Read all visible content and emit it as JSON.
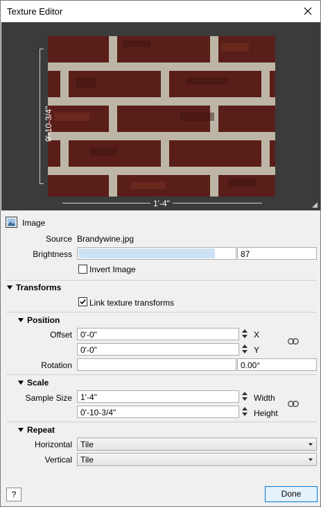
{
  "window": {
    "title": "Texture Editor"
  },
  "preview": {
    "height_label": "0'-10-3/4\"",
    "width_label": "1'-4\""
  },
  "image_section": {
    "label": "Image",
    "source_label": "Source",
    "source_value": "Brandywine.jpg",
    "brightness_label": "Brightness",
    "brightness_value": "87",
    "invert_label": "Invert Image",
    "invert_checked": false
  },
  "transforms": {
    "label": "Transforms",
    "link_label": "Link texture transforms",
    "link_checked": true
  },
  "position": {
    "label": "Position",
    "offset_label": "Offset",
    "offset_x": "0'-0\"",
    "offset_y": "0'-0\"",
    "x_label": "X",
    "y_label": "Y",
    "rotation_label": "Rotation",
    "rotation_value": "0.00°"
  },
  "scale": {
    "label": "Scale",
    "sample_size_label": "Sample Size",
    "width_value": "1'-4\"",
    "height_value": "0'-10-3/4\"",
    "width_label": "Width",
    "height_label": "Height"
  },
  "repeat": {
    "label": "Repeat",
    "horizontal_label": "Horizontal",
    "horizontal_value": "Tile",
    "vertical_label": "Vertical",
    "vertical_value": "Tile"
  },
  "footer": {
    "help_label": "?",
    "done_label": "Done"
  },
  "colors": {
    "brick": "#5a1e18",
    "mortar": "#bdb6a6",
    "preview_bg": "#3b3b3b",
    "accent": "#0078d7"
  },
  "icons": [
    "close-icon",
    "image-icon",
    "collapse-triangle-icon",
    "checkmark-icon",
    "spinner-icon",
    "chain-link-icon",
    "dropdown-arrow-icon"
  ]
}
